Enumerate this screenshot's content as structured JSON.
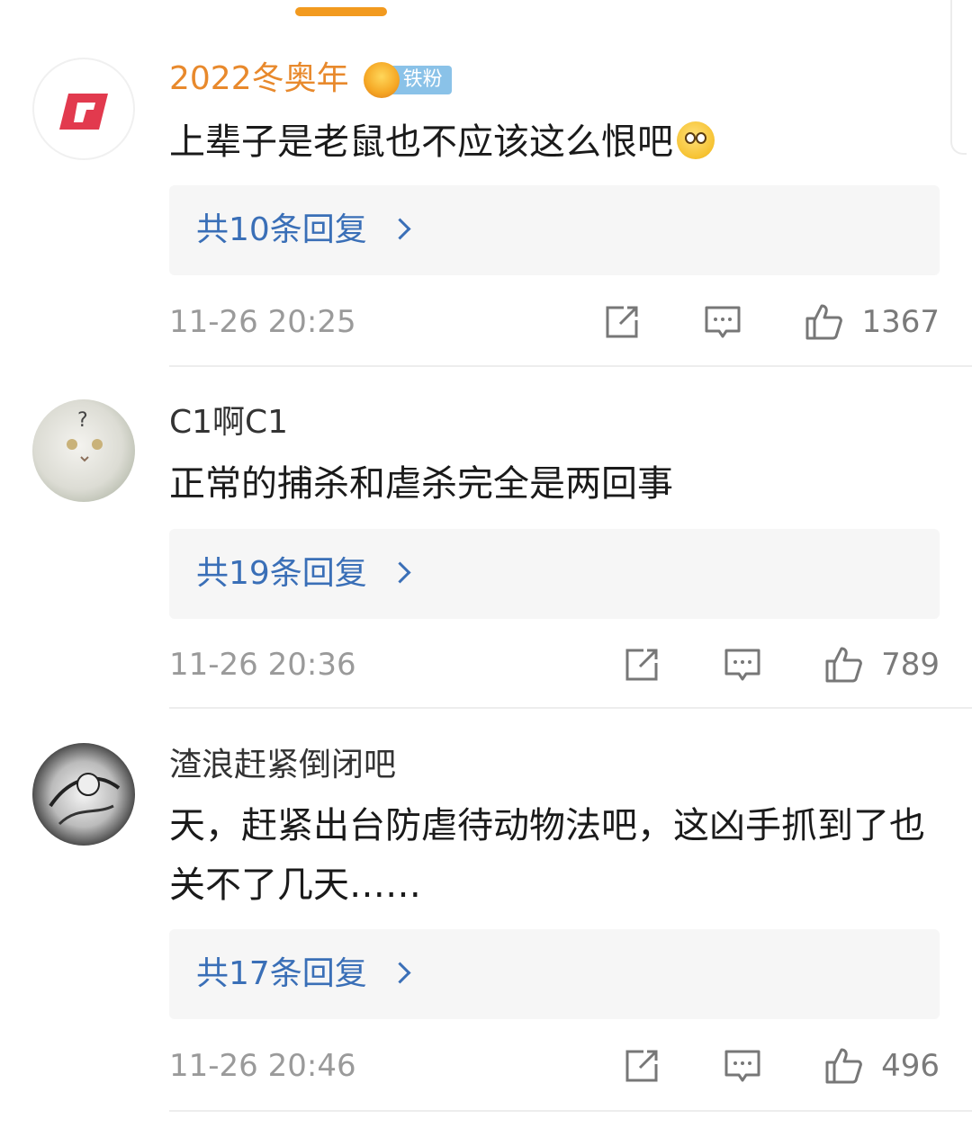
{
  "comments": [
    {
      "username": "2022冬奥年",
      "badge_label": "铁粉",
      "text": "上辈子是老鼠也不应该这么恨吧",
      "replies_label": "共10条回复",
      "timestamp": "11-26 20:25",
      "likes": "1367"
    },
    {
      "username": "C1啊C1",
      "text": "正常的捕杀和虐杀完全是两回事",
      "replies_label": "共19条回复",
      "timestamp": "11-26 20:36",
      "likes": "789"
    },
    {
      "username": "渣浪赶紧倒闭吧",
      "text": "天，赶紧出台防虐待动物法吧，这凶手抓到了也关不了几天……",
      "replies_label": "共17条回复",
      "timestamp": "11-26 20:46",
      "likes": "496"
    }
  ],
  "colors": {
    "vip_name": "#e8892c",
    "link_blue": "#3a6fb7",
    "meta_gray": "#9a9a9a",
    "reply_bg": "#f6f6f6",
    "indicator": "#f29a1f"
  },
  "icons": [
    "share-icon",
    "comment-icon",
    "like-icon"
  ]
}
